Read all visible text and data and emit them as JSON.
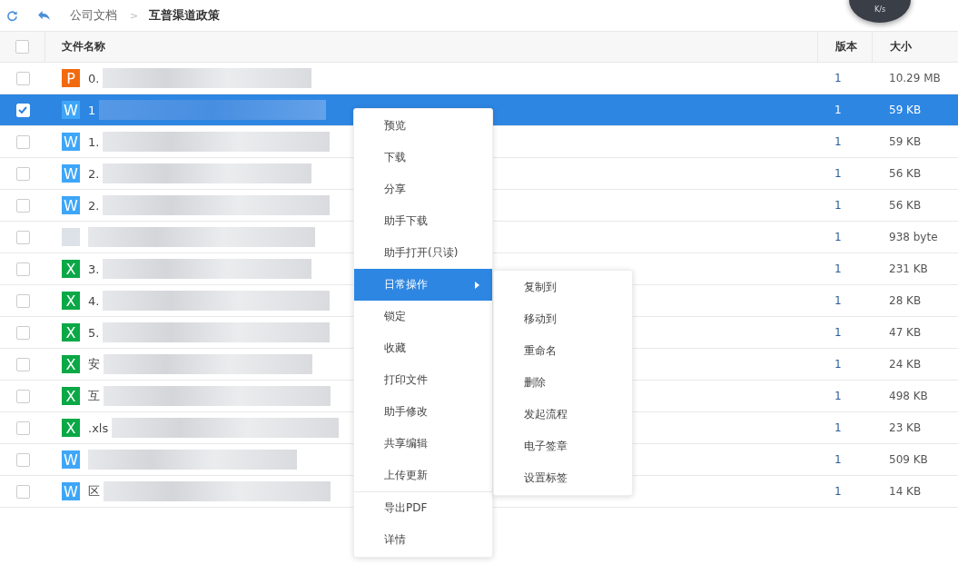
{
  "toolbar": {
    "breadcrumbs": [
      {
        "label": "公司文档",
        "current": false
      },
      {
        "label": "互普渠道政策",
        "current": true
      }
    ],
    "separator": ">"
  },
  "speed_widget": {
    "text": "K/s"
  },
  "table": {
    "select_all": {
      "checked": false
    },
    "columns": [
      "文件名称",
      "版本",
      "大小"
    ],
    "rows": [
      {
        "kind": "p",
        "icon_letter": "P",
        "name": "0.",
        "version": "1",
        "size": "10.29  MB",
        "selected": false
      },
      {
        "kind": "w",
        "icon_letter": "W",
        "name": "1",
        "version": "1",
        "size": "59  KB",
        "selected": true
      },
      {
        "kind": "w",
        "icon_letter": "W",
        "name": "1.",
        "version": "1",
        "size": "59  KB",
        "selected": false
      },
      {
        "kind": "w",
        "icon_letter": "W",
        "name": "2.",
        "version": "1",
        "size": "56  KB",
        "selected": false
      },
      {
        "kind": "w",
        "icon_letter": "W",
        "name": "2.",
        "version": "1",
        "size": "56  KB",
        "selected": false
      },
      {
        "kind": "blank",
        "version": "1",
        "size": "938  byte",
        "selected": false
      },
      {
        "kind": "x",
        "icon_letter": "X",
        "name": "3.",
        "version": "1",
        "size": "231  KB",
        "selected": false
      },
      {
        "kind": "x",
        "icon_letter": "X",
        "name": "4.",
        "version": "1",
        "size": "28  KB",
        "selected": false
      },
      {
        "kind": "x",
        "icon_letter": "X",
        "name": "5.",
        "version": "1",
        "size": "47  KB",
        "selected": false
      },
      {
        "kind": "x",
        "icon_letter": "X",
        "name": "安",
        "version": "1",
        "size": "24  KB",
        "selected": false
      },
      {
        "kind": "x",
        "icon_letter": "X",
        "name": "互",
        "version": "1",
        "size": "498  KB",
        "selected": false
      },
      {
        "kind": "x",
        "icon_letter": "X",
        "name": ".xls",
        "version": "1",
        "size": "23  KB",
        "selected": false
      },
      {
        "kind": "w",
        "icon_letter": "W",
        "version": "1",
        "size": "509  KB",
        "selected": false
      },
      {
        "kind": "w",
        "icon_letter": "W",
        "name": "区",
        "version": "1",
        "size": "14  KB",
        "selected": false
      }
    ]
  },
  "context_menu": {
    "groups": [
      [
        {
          "label": "预览",
          "selected": false
        },
        {
          "label": "下载",
          "selected": false
        },
        {
          "label": "分享",
          "selected": false
        },
        {
          "label": "助手下载",
          "selected": false
        },
        {
          "label": "助手打开(只读)",
          "selected": false
        },
        {
          "label": "日常操作",
          "selected": true,
          "submenu": true
        },
        {
          "label": "锁定",
          "selected": false
        },
        {
          "label": "收藏",
          "selected": false
        },
        {
          "label": "打印文件",
          "selected": false
        },
        {
          "label": "助手修改",
          "selected": false
        },
        {
          "label": "共享编辑",
          "selected": false
        },
        {
          "label": "上传更新",
          "selected": false
        }
      ],
      [
        {
          "label": "导出PDF",
          "selected": false
        },
        {
          "label": "详情",
          "selected": false
        }
      ]
    ]
  },
  "submenu": {
    "items": [
      "复制到",
      "移动到",
      "重命名",
      "删除",
      "发起流程",
      "电子签章",
      "设置标签"
    ]
  }
}
